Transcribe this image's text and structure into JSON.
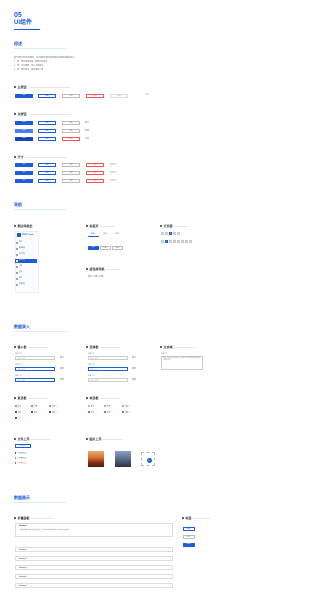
{
  "header": {
    "number": "05",
    "title": "UI组件"
  },
  "colors": {
    "primary": "#1e5bd8",
    "danger": "#e55555"
  },
  "sections": {
    "intro": {
      "title": "综述",
      "lines": [
        "基于组件化开发的规范，设计规范内所有组件都是可复用的模块单元。",
        "1、统一组件视觉风格，提高开发效率",
        "2、统一交互规则，减少认知成本",
        "3、统一组件状态，保证体验一致"
      ]
    },
    "buttons": {
      "title": "按钮",
      "subtitle_primary": "主按钮",
      "subtitle_secondary": "次按钮",
      "subtitle_size": "尺寸",
      "label": "按钮",
      "size_labels": [
        "大尺寸",
        "中尺寸",
        "小尺寸"
      ],
      "state_labels": [
        "默认",
        "悬停",
        "点击"
      ]
    },
    "nav": {
      "title": "导航",
      "sub_menu": "侧边导航栏",
      "sub_tabs": "标签页",
      "sub_pager": "分页器",
      "sub_breadcrumb": "面包屑导航",
      "brand": "RYAT Cloud",
      "menu": [
        "首页",
        "数据概览",
        "资产管理",
        "用户中心",
        "订单",
        "设置",
        "帮助",
        "系统管理"
      ],
      "tabs": [
        "标签一",
        "标签二",
        "标签三"
      ],
      "pages": [
        "<",
        "1",
        "2",
        "3",
        "4",
        "5",
        "6",
        ">"
      ],
      "breadcrumb": "首页 / 列表 / 详情"
    },
    "input": {
      "title": "数据录入",
      "sub_input": "输入框",
      "sub_select": "选择框",
      "sub_textarea": "文本域",
      "sub_checkbox": "复选框",
      "sub_radio": "单选框",
      "sub_upload": "文件上传",
      "sub_image": "图片上传",
      "field_label": "标签文字",
      "placeholder": "请输入内容",
      "state_labels": [
        "默认",
        "激活",
        "错误"
      ],
      "options": [
        "选项一",
        "选项二",
        "选项三"
      ],
      "checkbox_states": [
        "默认",
        "选中",
        "禁用"
      ],
      "textarea_text": "这是一段示例文本内容，用于展示文本域组件的样式效果与排版方式。",
      "upload_btn": "上传文件",
      "files": [
        "文件名称.doc",
        "文件名称.pdf",
        "文件名称.xls"
      ],
      "add_image": "+"
    },
    "display": {
      "title": "数据展示",
      "sub_collapse": "折叠面板",
      "sub_tag": "标签",
      "rows": [
        "Heading 1",
        "Heading 2",
        "Heading 3",
        "Heading 4",
        "Heading 5",
        "Heading 6"
      ],
      "row_body": "这里是折叠面板展开后的内容区域，用于放置详细的说明文字与补充信息内容展示。",
      "tags": [
        "标签一",
        "标签二",
        "标签三"
      ]
    }
  }
}
